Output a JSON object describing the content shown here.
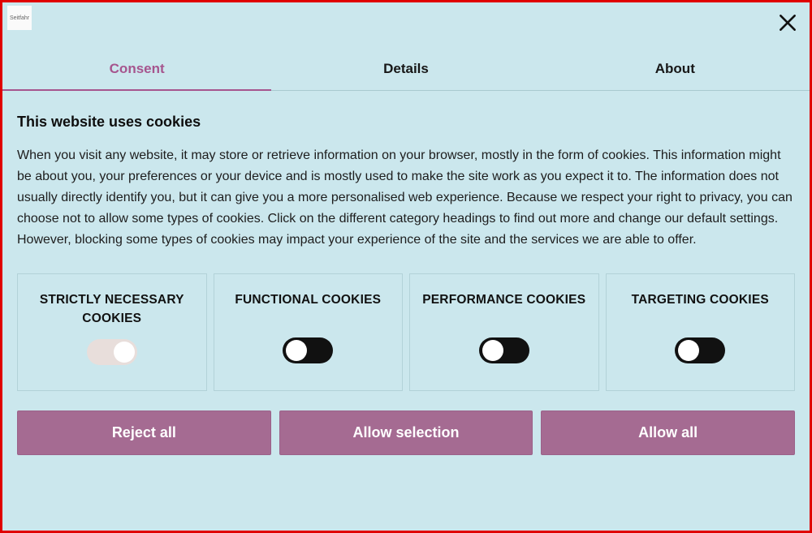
{
  "logo_text": "Seitfahr",
  "tabs": {
    "consent": "Consent",
    "details": "Details",
    "about": "About"
  },
  "heading": "This website uses cookies",
  "body": "When you visit any website, it may store or retrieve information on your browser, mostly in the form of cookies. This information might be about you, your preferences or your device and is mostly used to make the site work as you expect it to. The information does not usually directly identify you, but it can give you a more personalised web experience. Because we respect your right to privacy, you can choose not to allow some types of cookies. Click on the different category headings to find out more and change our default settings. However, blocking some types of cookies may impact your experience of the site and the services we are able to offer.",
  "categories": [
    {
      "title": "STRICTLY NECESSARY COOKIES",
      "state": "disabled"
    },
    {
      "title": "FUNCTIONAL COOKIES",
      "state": "off"
    },
    {
      "title": "PERFORMANCE COOKIES",
      "state": "off"
    },
    {
      "title": "TARGETING COOKIES",
      "state": "off"
    }
  ],
  "buttons": {
    "reject": "Reject all",
    "selection": "Allow selection",
    "all": "Allow all"
  }
}
